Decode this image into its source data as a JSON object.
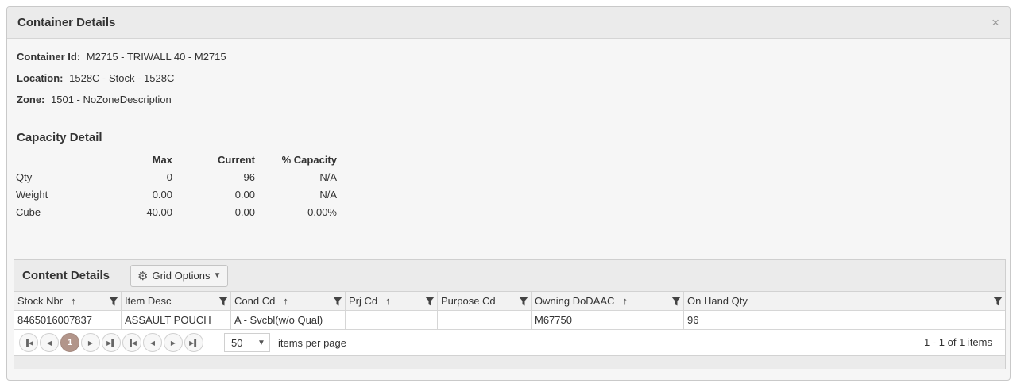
{
  "window": {
    "title": "Container Details",
    "close_glyph": "×"
  },
  "info": {
    "container_id_label": "Container Id:",
    "container_id_value": "M2715 - TRIWALL 40 - M2715",
    "location_label": "Location:",
    "location_value": "1528C - Stock - 1528C",
    "zone_label": "Zone:",
    "zone_value": "1501 - NoZoneDescription"
  },
  "capacity": {
    "title": "Capacity Detail",
    "headers": [
      "",
      "Max",
      "Current",
      "% Capacity"
    ],
    "rows": [
      {
        "label": "Qty",
        "max": "0",
        "current": "96",
        "pct": "N/A"
      },
      {
        "label": "Weight",
        "max": "0.00",
        "current": "0.00",
        "pct": "N/A"
      },
      {
        "label": "Cube",
        "max": "40.00",
        "current": "0.00",
        "pct": "0.00%"
      }
    ]
  },
  "content": {
    "title": "Content Details",
    "grid_options_label": "Grid Options",
    "columns": [
      {
        "label": "Stock Nbr",
        "sort": "↑"
      },
      {
        "label": "Item Desc",
        "sort": ""
      },
      {
        "label": "Cond Cd",
        "sort": "↑"
      },
      {
        "label": "Prj Cd",
        "sort": "↑"
      },
      {
        "label": "Purpose Cd",
        "sort": ""
      },
      {
        "label": "Owning DoDAAC",
        "sort": "↑"
      },
      {
        "label": "On Hand Qty",
        "sort": ""
      }
    ],
    "rows": [
      [
        "8465016007837",
        "ASSAULT POUCH",
        "A - Svcbl(w/o Qual)",
        "",
        "",
        "M67750",
        "96"
      ]
    ],
    "pager": {
      "current_page": "1",
      "page_size": "50",
      "items_per_page_label": "items per page",
      "info": "1 - 1 of 1 items"
    }
  },
  "colors": {
    "active_page": "#b2958a",
    "header_bg": "#ebebeb"
  }
}
